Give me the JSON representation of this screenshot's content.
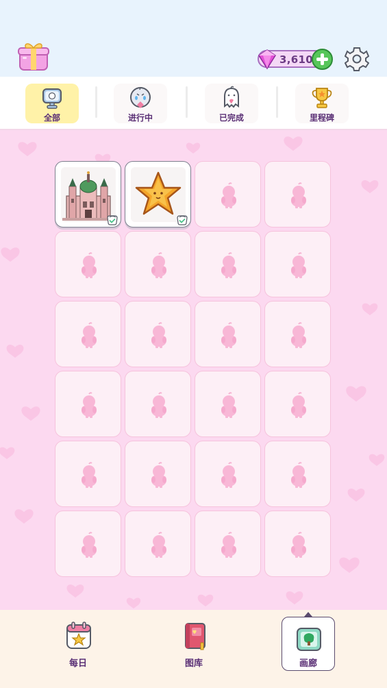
{
  "header": {
    "gift_icon": "gift-box-icon",
    "gems": "3,610",
    "gem_icon": "pink-gem-icon",
    "add_icon": "plus-icon",
    "settings_icon": "gear-icon"
  },
  "filters": [
    {
      "label": "全部",
      "icon": "monitor-icon",
      "active": true
    },
    {
      "label": "进行中",
      "icon": "crying-ghost-icon",
      "active": false
    },
    {
      "label": "已完成",
      "icon": "ghost-heart-icon",
      "active": false
    },
    {
      "label": "里程碑",
      "icon": "trophy-icon",
      "active": false
    }
  ],
  "gallery": {
    "rows": 6,
    "cols": 4,
    "completed": [
      {
        "art": "castle-icon",
        "badge": "check-icon"
      },
      {
        "art": "star-icon",
        "badge": "check-icon"
      }
    ],
    "locked_icon": "chick-silhouette-icon"
  },
  "nav": [
    {
      "label": "每日",
      "icon": "calendar-icon",
      "active": false
    },
    {
      "label": "图库",
      "icon": "book-icon",
      "active": false
    },
    {
      "label": "画廊",
      "icon": "gallery-frame-icon",
      "active": true
    }
  ],
  "colors": {
    "header_bg": "#e8f3fd",
    "main_bg": "#fcd9f0",
    "active_tab": "#fff2a8",
    "text_purple": "#5a2f75",
    "add_green": "#57c65a"
  }
}
